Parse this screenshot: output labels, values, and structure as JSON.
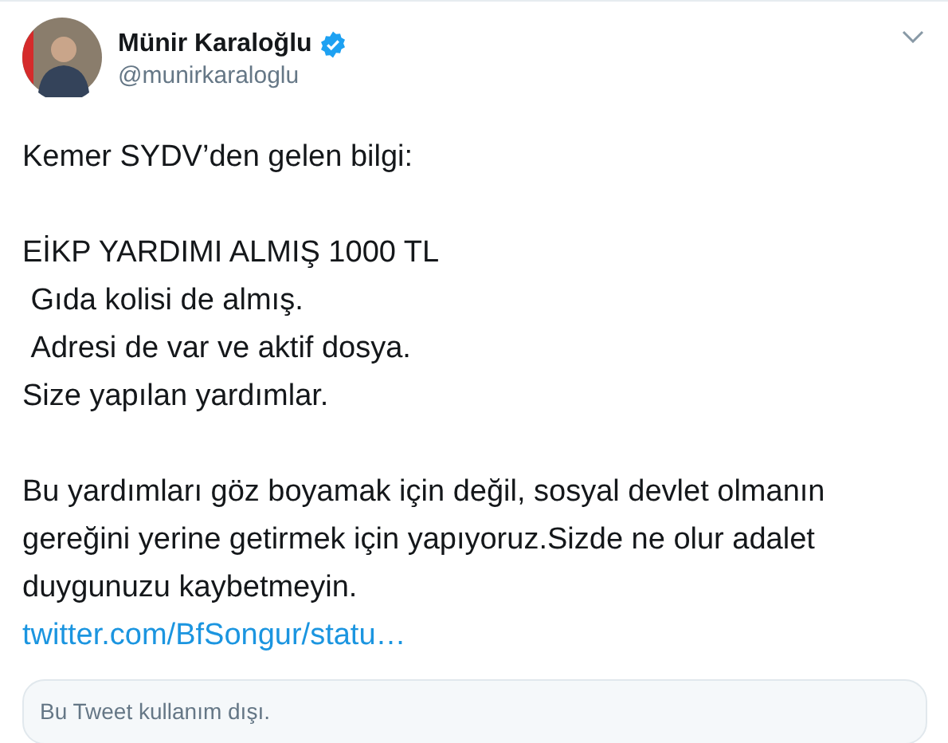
{
  "author": {
    "name": "Münir Karaloğlu",
    "handle": "@munirkaraloglu",
    "verified": true
  },
  "body": [
    {
      "kind": "line",
      "text": "Kemer SYDV’den gelen bilgi:"
    },
    {
      "kind": "gap"
    },
    {
      "kind": "line",
      "text": "EİKP YARDIMI ALMIŞ 1000 TL"
    },
    {
      "kind": "line",
      "text": " Gıda kolisi de almış."
    },
    {
      "kind": "line",
      "text": " Adresi de var ve aktif dosya."
    },
    {
      "kind": "line",
      "text": "Size yapılan yardımlar."
    },
    {
      "kind": "gap"
    },
    {
      "kind": "line",
      "text": "Bu yardımları göz boyamak için değil, sosyal devlet olmanın gereğini yerine getirmek için yapıyoruz.Sizde ne olur adalet duygunuzu kaybetmeyin."
    },
    {
      "kind": "link",
      "text": "twitter.com/BfSongur/statu…"
    }
  ],
  "quoted_tweet": {
    "notice": "Bu Tweet kullanım dışı."
  }
}
